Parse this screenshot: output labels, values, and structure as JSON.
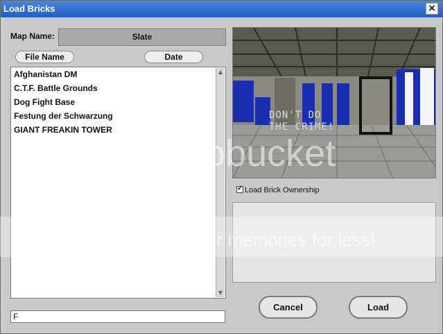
{
  "window": {
    "title": "Load Bricks",
    "close_label": "×"
  },
  "mapname": {
    "label": "Map Name:",
    "value": "Slate"
  },
  "sort": {
    "file_name": "File Name",
    "date": "Date"
  },
  "files": [
    "Afghanistan DM",
    "C.T.F. Battle Grounds",
    "Dog Fight Base",
    "Festung der Schwarzung",
    "GIANT FREAKIN TOWER"
  ],
  "filename_input": {
    "value": "F"
  },
  "preview": {
    "line1": "DON'T DO",
    "line2": "THE CRIME!"
  },
  "options": {
    "ownership_label": "Load Brick Ownership",
    "ownership_checked": true
  },
  "buttons": {
    "cancel": "Cancel",
    "load": "Load"
  },
  "watermark": {
    "brand": "otobucket",
    "tagline": "ur memories for less!"
  }
}
